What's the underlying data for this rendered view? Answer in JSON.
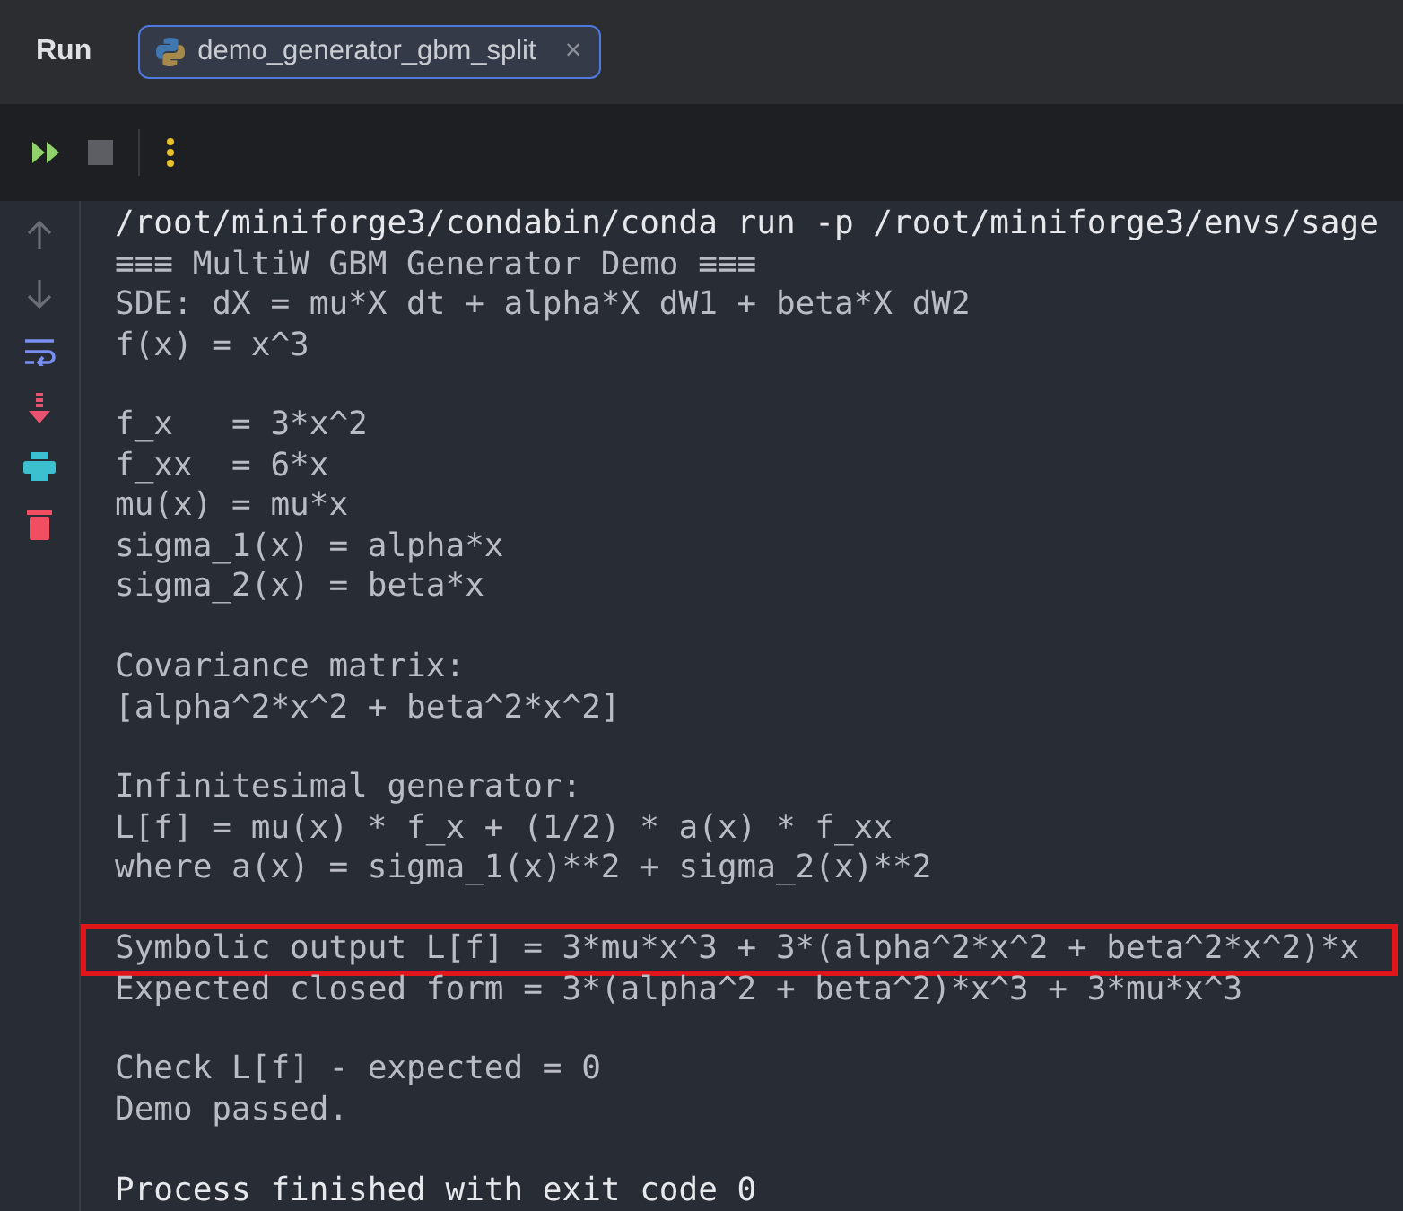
{
  "panel": {
    "title": "Run"
  },
  "tabs": [
    {
      "label": "demo_generator_gbm_split",
      "selected": true,
      "close": "×"
    }
  ],
  "console": {
    "lines": [
      {
        "kind": "command",
        "text": "/root/miniforge3/condabin/conda run -p /root/miniforge3/envs/sage"
      },
      {
        "kind": "output",
        "text": "≡≡≡ MultiW GBM Generator Demo ≡≡≡"
      },
      {
        "kind": "output",
        "text": "SDE: dX = mu*X dt + alpha*X dW1 + beta*X dW2"
      },
      {
        "kind": "output",
        "text": "f(x) = x^3"
      },
      {
        "kind": "blank"
      },
      {
        "kind": "output",
        "text": "f_x   = 3*x^2"
      },
      {
        "kind": "output",
        "text": "f_xx  = 6*x"
      },
      {
        "kind": "output",
        "text": "mu(x) = mu*x"
      },
      {
        "kind": "output",
        "text": "sigma_1(x) = alpha*x"
      },
      {
        "kind": "output",
        "text": "sigma_2(x) = beta*x"
      },
      {
        "kind": "blank"
      },
      {
        "kind": "output",
        "text": "Covariance matrix:"
      },
      {
        "kind": "output",
        "text": "[alpha^2*x^2 + beta^2*x^2]"
      },
      {
        "kind": "blank"
      },
      {
        "kind": "output",
        "text": "Infinitesimal generator:"
      },
      {
        "kind": "output",
        "text": "L[f] = mu(x) * f_x + (1/2) * a(x) * f_xx"
      },
      {
        "kind": "output",
        "text": "where a(x) = sigma_1(x)**2 + sigma_2(x)**2"
      },
      {
        "kind": "blank"
      },
      {
        "kind": "highlighted",
        "text": "Symbolic output L[f] = 3*mu*x^3 + 3*(alpha^2*x^2 + beta^2*x^2)*x"
      },
      {
        "kind": "output",
        "text": "Expected closed form = 3*(alpha^2 + beta^2)*x^3 + 3*mu*x^3"
      },
      {
        "kind": "blank"
      },
      {
        "kind": "output",
        "text": "Check L[f] - expected = 0"
      },
      {
        "kind": "output",
        "text": "Demo passed."
      },
      {
        "kind": "blank"
      },
      {
        "kind": "command",
        "text": "Process finished with exit code 0"
      }
    ]
  }
}
